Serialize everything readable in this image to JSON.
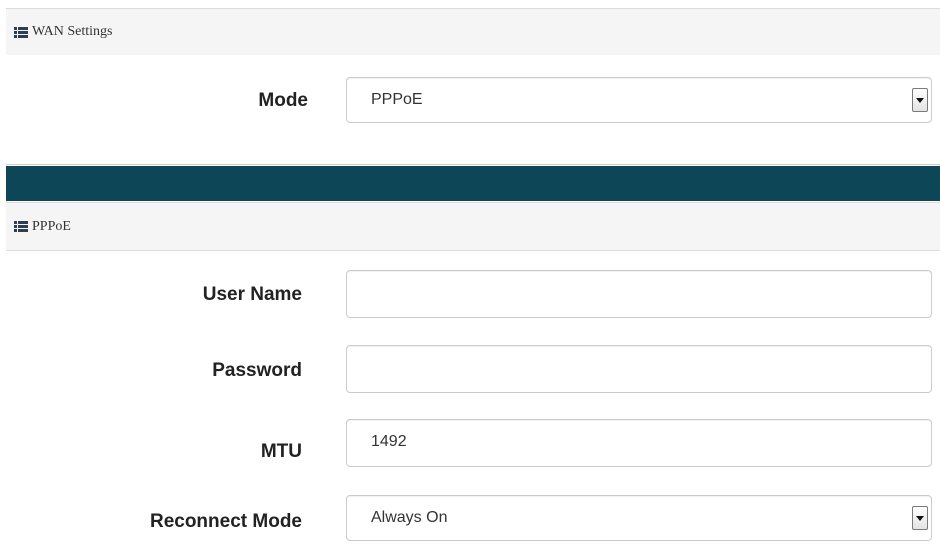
{
  "wan_settings": {
    "header": "WAN Settings",
    "header_icon": "list-icon",
    "mode_label": "Mode",
    "mode_value": "PPPoE"
  },
  "pppoe": {
    "header": "PPPoE",
    "header_icon": "list-icon",
    "username_label": "User Name",
    "username_value": "",
    "password_label": "Password",
    "password_value": "",
    "mtu_label": "MTU",
    "mtu_value": "1492",
    "reconnect_label": "Reconnect Mode",
    "reconnect_value": "Always On"
  },
  "colors": {
    "band": "#0d4757",
    "header_bg": "#f5f5f5"
  }
}
